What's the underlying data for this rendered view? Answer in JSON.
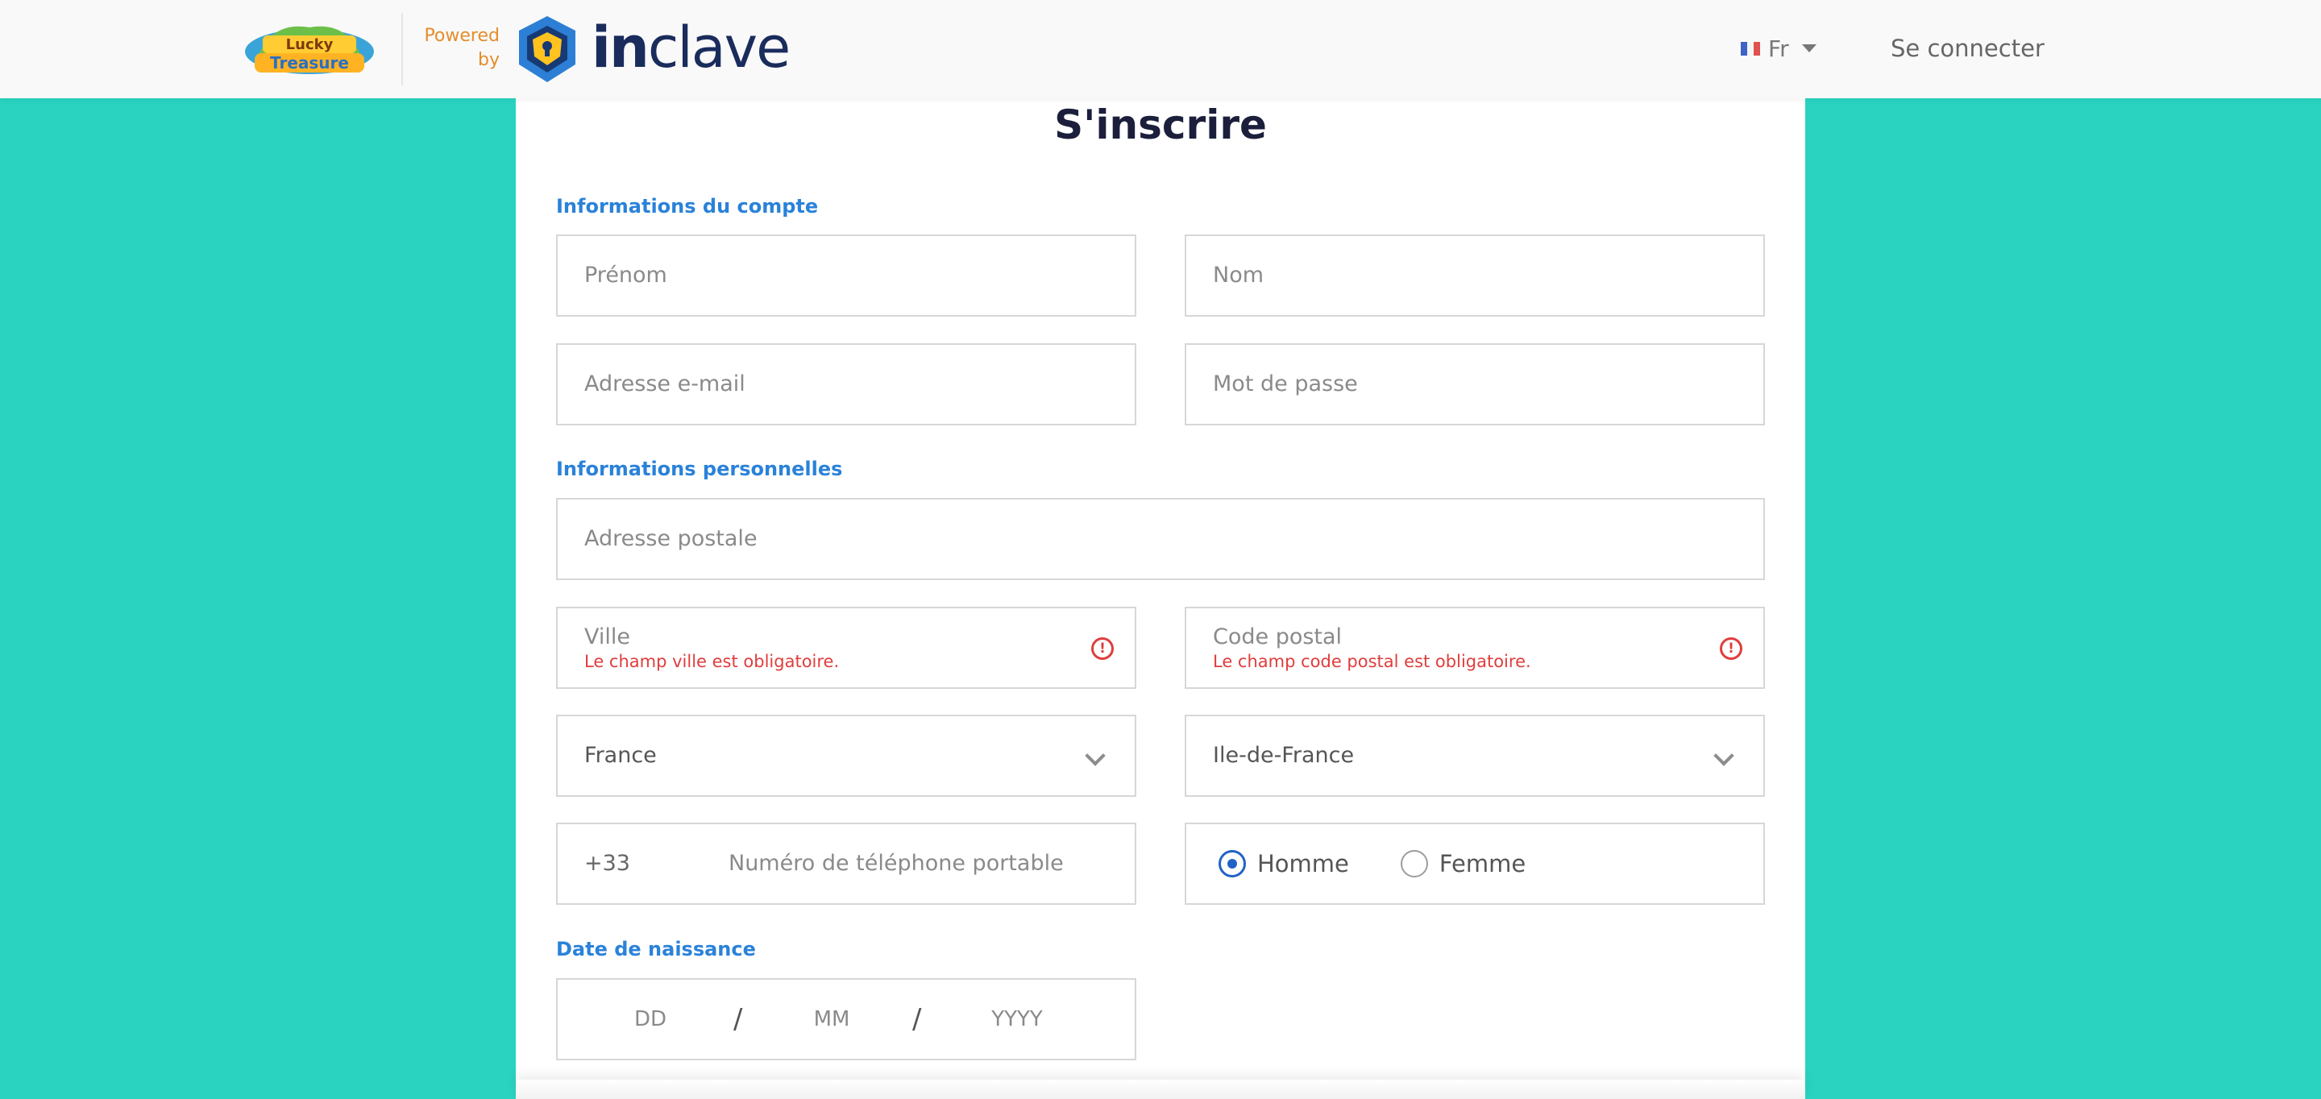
{
  "header": {
    "brand_logo_text_top": "Lucky",
    "brand_logo_text_bottom": "Treasure",
    "powered_line1": "Powered",
    "powered_line2": "by",
    "inclave_bold": "in",
    "inclave_light": "clave",
    "language": "Fr",
    "login_label": "Se connecter"
  },
  "form": {
    "title": "S'inscrire",
    "section_account": "Informations du compte",
    "first_name_placeholder": "Prénom",
    "last_name_placeholder": "Nom",
    "email_placeholder": "Adresse e-mail",
    "password_placeholder": "Mot de passe",
    "section_personal": "Informations personnelles",
    "address_placeholder": "Adresse postale",
    "city_placeholder": "Ville",
    "city_error": "Le champ ville est obligatoire.",
    "zip_placeholder": "Code postal",
    "zip_error": "Le champ code postal est obligatoire.",
    "country_value": "France",
    "region_value": "Ile-de-France",
    "dial_code": "+33",
    "phone_placeholder": "Numéro de téléphone portable",
    "gender_male": "Homme",
    "gender_female": "Femme",
    "gender_selected": "Homme",
    "section_dob": "Date de naissance",
    "dob_day": "DD",
    "dob_month": "MM",
    "dob_year": "YYYY",
    "dob_separator": "/"
  },
  "colors": {
    "background": "#29d3bf",
    "accent_blue": "#2a82d9",
    "error_red": "#e03d3d",
    "powered_orange": "#e48d2a",
    "inclave_navy": "#1a2c5c"
  },
  "icons": [
    "brand-logo",
    "inclave-shield-icon",
    "flag-fr-icon",
    "caret-down-icon",
    "error-icon",
    "chevron-down-icon",
    "radio-icon"
  ]
}
